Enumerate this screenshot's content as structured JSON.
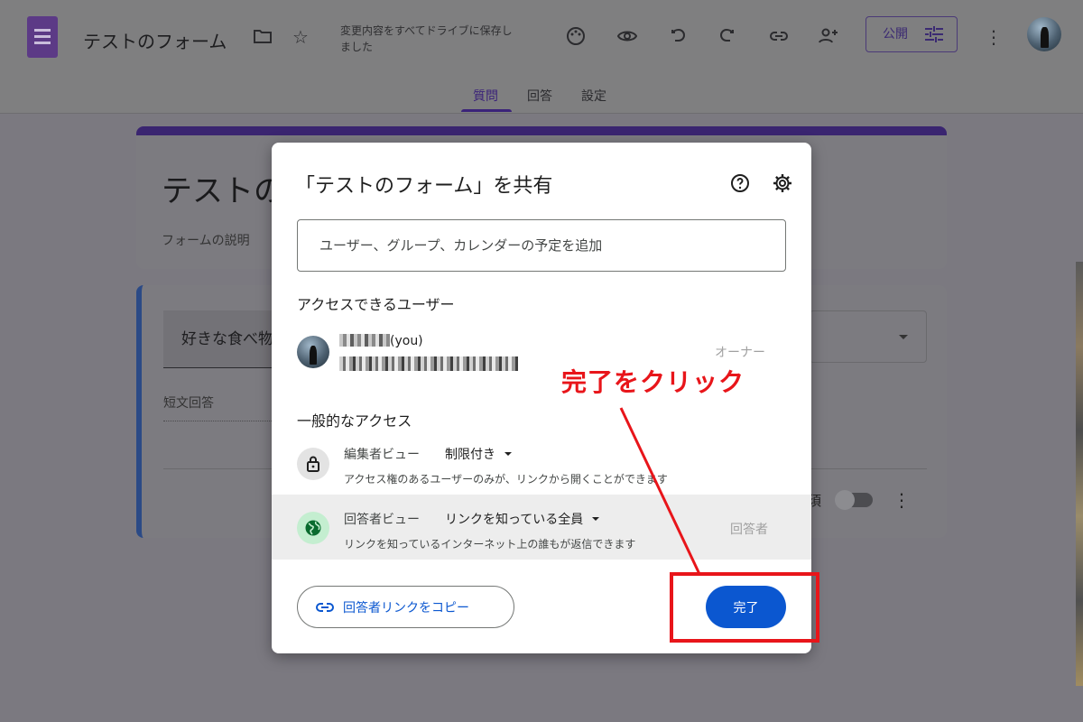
{
  "app": {
    "title": "テストのフォーム",
    "save_status": "変更内容をすべてドライブに保存しました",
    "publish_label": "公開"
  },
  "toolbar": {
    "icons": [
      "folder-icon",
      "star-icon",
      "palette-icon",
      "preview-eye-icon",
      "undo-icon",
      "redo-icon",
      "link-icon",
      "add-collaborator-icon",
      "more-vert-icon"
    ]
  },
  "tabs": [
    {
      "label": "質問",
      "active": true
    },
    {
      "label": "回答",
      "active": false
    },
    {
      "label": "設定",
      "active": false
    }
  ],
  "form": {
    "title_partial": "テストの",
    "description_partial": "フォームの説明",
    "question_partial": "好きな食べ物",
    "answer_placeholder": "短文回答",
    "required_partial": "須"
  },
  "share_dialog": {
    "title": "「テストのフォーム」を共有",
    "add_placeholder": "ユーザー、グループ、カレンダーの予定を追加",
    "people_heading": "アクセスできるユーザー",
    "owner": {
      "name_suffix": "(you)",
      "role": "オーナー"
    },
    "general_heading": "一般的なアクセス",
    "editor_access": {
      "label": "編集者ビュー",
      "value": "制限付き",
      "description": "アクセス権のあるユーザーのみが、リンクから開くことができます"
    },
    "responder_access": {
      "label": "回答者ビュー",
      "value": "リンクを知っている全員",
      "description": "リンクを知っているインターネット上の誰もが返信できます",
      "role": "回答者"
    },
    "copy_link_label": "回答者リンクをコピー",
    "done_label": "完了"
  },
  "annotation": {
    "text": "完了をクリック",
    "color": "#e8151a"
  },
  "colors": {
    "accent_blue": "#0b57d0",
    "forms_purple": "#3b2379"
  }
}
